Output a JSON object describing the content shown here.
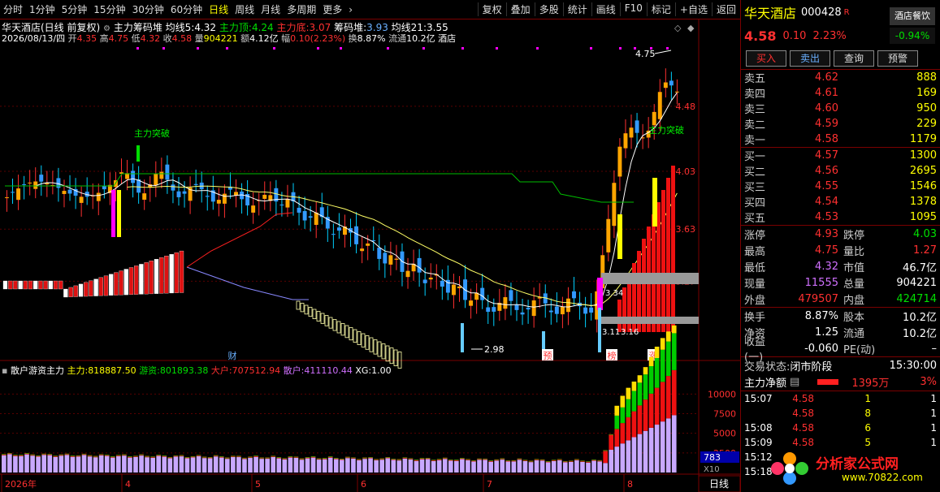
{
  "toolbar": {
    "periods": [
      "分时",
      "1分钟",
      "5分钟",
      "15分钟",
      "30分钟",
      "60分钟",
      "日线",
      "周线",
      "月线",
      "多周期",
      "更多"
    ],
    "active": "日线",
    "more_arrow": "›",
    "right": [
      "复权",
      "叠加",
      "多股",
      "统计",
      "画线",
      "F10",
      "标记",
      "+自选",
      "返回"
    ]
  },
  "info": {
    "title": "华天酒店(日线 前复权)",
    "indicator": "主力筹码堆",
    "ma5_label": "均线5:",
    "ma5": "4.32",
    "top_label": "主力顶:",
    "top": "4.24",
    "bottom_label": "主力底:",
    "bottom": "3.07",
    "chip_label": "筹码堆:",
    "chip": "3.93",
    "ma21_label": "均线21:",
    "ma21": "3.55",
    "date": "2026/08/13/四",
    "open_label": "开",
    "open": "4.35",
    "high_label": "高",
    "high": "4.75",
    "low_label": "低",
    "low": "4.32",
    "close_label": "收",
    "close": "4.58",
    "vol_label": "量",
    "vol": "904221",
    "amt_label": "额",
    "amt": "4.12亿",
    "amp_label": "幅",
    "amp": "0.10(2.23%)",
    "turn_label": "换",
    "turn": "8.87%",
    "float_label": "流通",
    "float": "10.2亿",
    "industry": "酒店"
  },
  "chart_labels": {
    "breakout1": "主力突破",
    "breakout2": "主力突破",
    "high_mark": "4.75",
    "low_mark": "2.98",
    "mark_a": "3.34",
    "mark_b": "3.11",
    "mark_c": "3.16",
    "tag_cai": "财",
    "tag_yu": "预",
    "tag_bang": "榜",
    "tag_zhang": "涨",
    "collapse_icon": "◇",
    "gear_icon": "◆"
  },
  "price_axis": [
    "4.48",
    "4.03",
    "3.63",
    "3.27"
  ],
  "vol_axis": [
    "10000",
    "7500",
    "5000",
    "2500"
  ],
  "vol_axis_box": "783",
  "vol_axis_unit": "X10",
  "date_axis": [
    "2026年",
    "4",
    "5",
    "6",
    "7",
    "8"
  ],
  "period_tab": "日线",
  "sub": {
    "name": "散户游资主力",
    "main_label": "主力:",
    "main": "818887.50",
    "hot_label": "游资:",
    "hot": "801893.38",
    "big_label": "大户:",
    "big": "707512.94",
    "retail_label": "散户:",
    "retail": "411110.44",
    "xg_label": "XG:",
    "xg": "1.00"
  },
  "panel": {
    "name": "华天酒店",
    "code": "000428",
    "r": "R",
    "tag": "酒店餐饮",
    "price": "4.58",
    "change": "0.10",
    "pct": "2.23%",
    "tag_pct": "-0.94%",
    "btn_buy": "买入",
    "btn_sell": "卖出",
    "btn_query": "查询",
    "btn_warn": "预警",
    "asks": [
      {
        "label": "卖五",
        "price": "4.62",
        "vol": "888"
      },
      {
        "label": "卖四",
        "price": "4.61",
        "vol": "169"
      },
      {
        "label": "卖三",
        "price": "4.60",
        "vol": "950"
      },
      {
        "label": "卖二",
        "price": "4.59",
        "vol": "229"
      },
      {
        "label": "卖一",
        "price": "4.58",
        "vol": "1179"
      }
    ],
    "bids": [
      {
        "label": "买一",
        "price": "4.57",
        "vol": "1300"
      },
      {
        "label": "买二",
        "price": "4.56",
        "vol": "2695"
      },
      {
        "label": "买三",
        "price": "4.55",
        "vol": "1546"
      },
      {
        "label": "买四",
        "price": "4.54",
        "vol": "1378"
      },
      {
        "label": "买五",
        "price": "4.53",
        "vol": "1095"
      }
    ],
    "quote": [
      {
        "l1": "涨停",
        "v1": "4.93",
        "c1": "red",
        "l2": "跌停",
        "v2": "4.03",
        "c2": "green"
      },
      {
        "l1": "最高",
        "v1": "4.75",
        "c1": "red",
        "l2": "量比",
        "v2": "1.27",
        "c2": "red"
      },
      {
        "l1": "最低",
        "v1": "4.32",
        "c1": "purple",
        "l2": "市值",
        "v2": "46.7亿",
        "c2": "white"
      },
      {
        "l1": "现量",
        "v1": "11555",
        "c1": "purple",
        "l2": "总量",
        "v2": "904221",
        "c2": "white"
      },
      {
        "l1": "外盘",
        "v1": "479507",
        "c1": "red",
        "l2": "内盘",
        "v2": "424714",
        "c2": "green"
      }
    ],
    "quote2": [
      {
        "l1": "换手",
        "v1": "8.87%",
        "c1": "white",
        "l2": "股本",
        "v2": "10.2亿",
        "c2": "white"
      },
      {
        "l1": "净资",
        "v1": "1.25",
        "c1": "white",
        "l2": "流通",
        "v2": "10.2亿",
        "c2": "white"
      },
      {
        "l1": "收益(一)",
        "v1": "-0.060",
        "c1": "white",
        "l2": "PE(动)",
        "v2": "–",
        "c2": "white"
      }
    ],
    "state_label": "交易状态:",
    "state": "闭市阶段",
    "state_time": "15:30:00",
    "flow_label": "主力净额",
    "flow_val": "1395万",
    "flow_pct": "3%",
    "ticks": [
      {
        "time": "15:07",
        "price": "4.58",
        "vol": "1",
        "n": "1"
      },
      {
        "time": "",
        "price": "4.58",
        "vol": "8",
        "n": "1"
      },
      {
        "time": "15:08",
        "price": "4.58",
        "vol": "6",
        "n": "1"
      },
      {
        "time": "15:09",
        "price": "4.58",
        "vol": "5",
        "n": "1"
      },
      {
        "time": "15:12",
        "price": "",
        "vol": "",
        "n": ""
      },
      {
        "time": "15:18",
        "price": "",
        "vol": "",
        "n": ""
      }
    ],
    "logo_text": "分析家公式网",
    "logo_url": "www.70822.com"
  },
  "colors": {
    "up": "#ff3030",
    "down": "#00e0e0",
    "ma5": "#ffffff",
    "ma21": "#ffff66",
    "top": "#00cc00",
    "bottom": "#8888ff",
    "grid": "#7a0000"
  }
}
